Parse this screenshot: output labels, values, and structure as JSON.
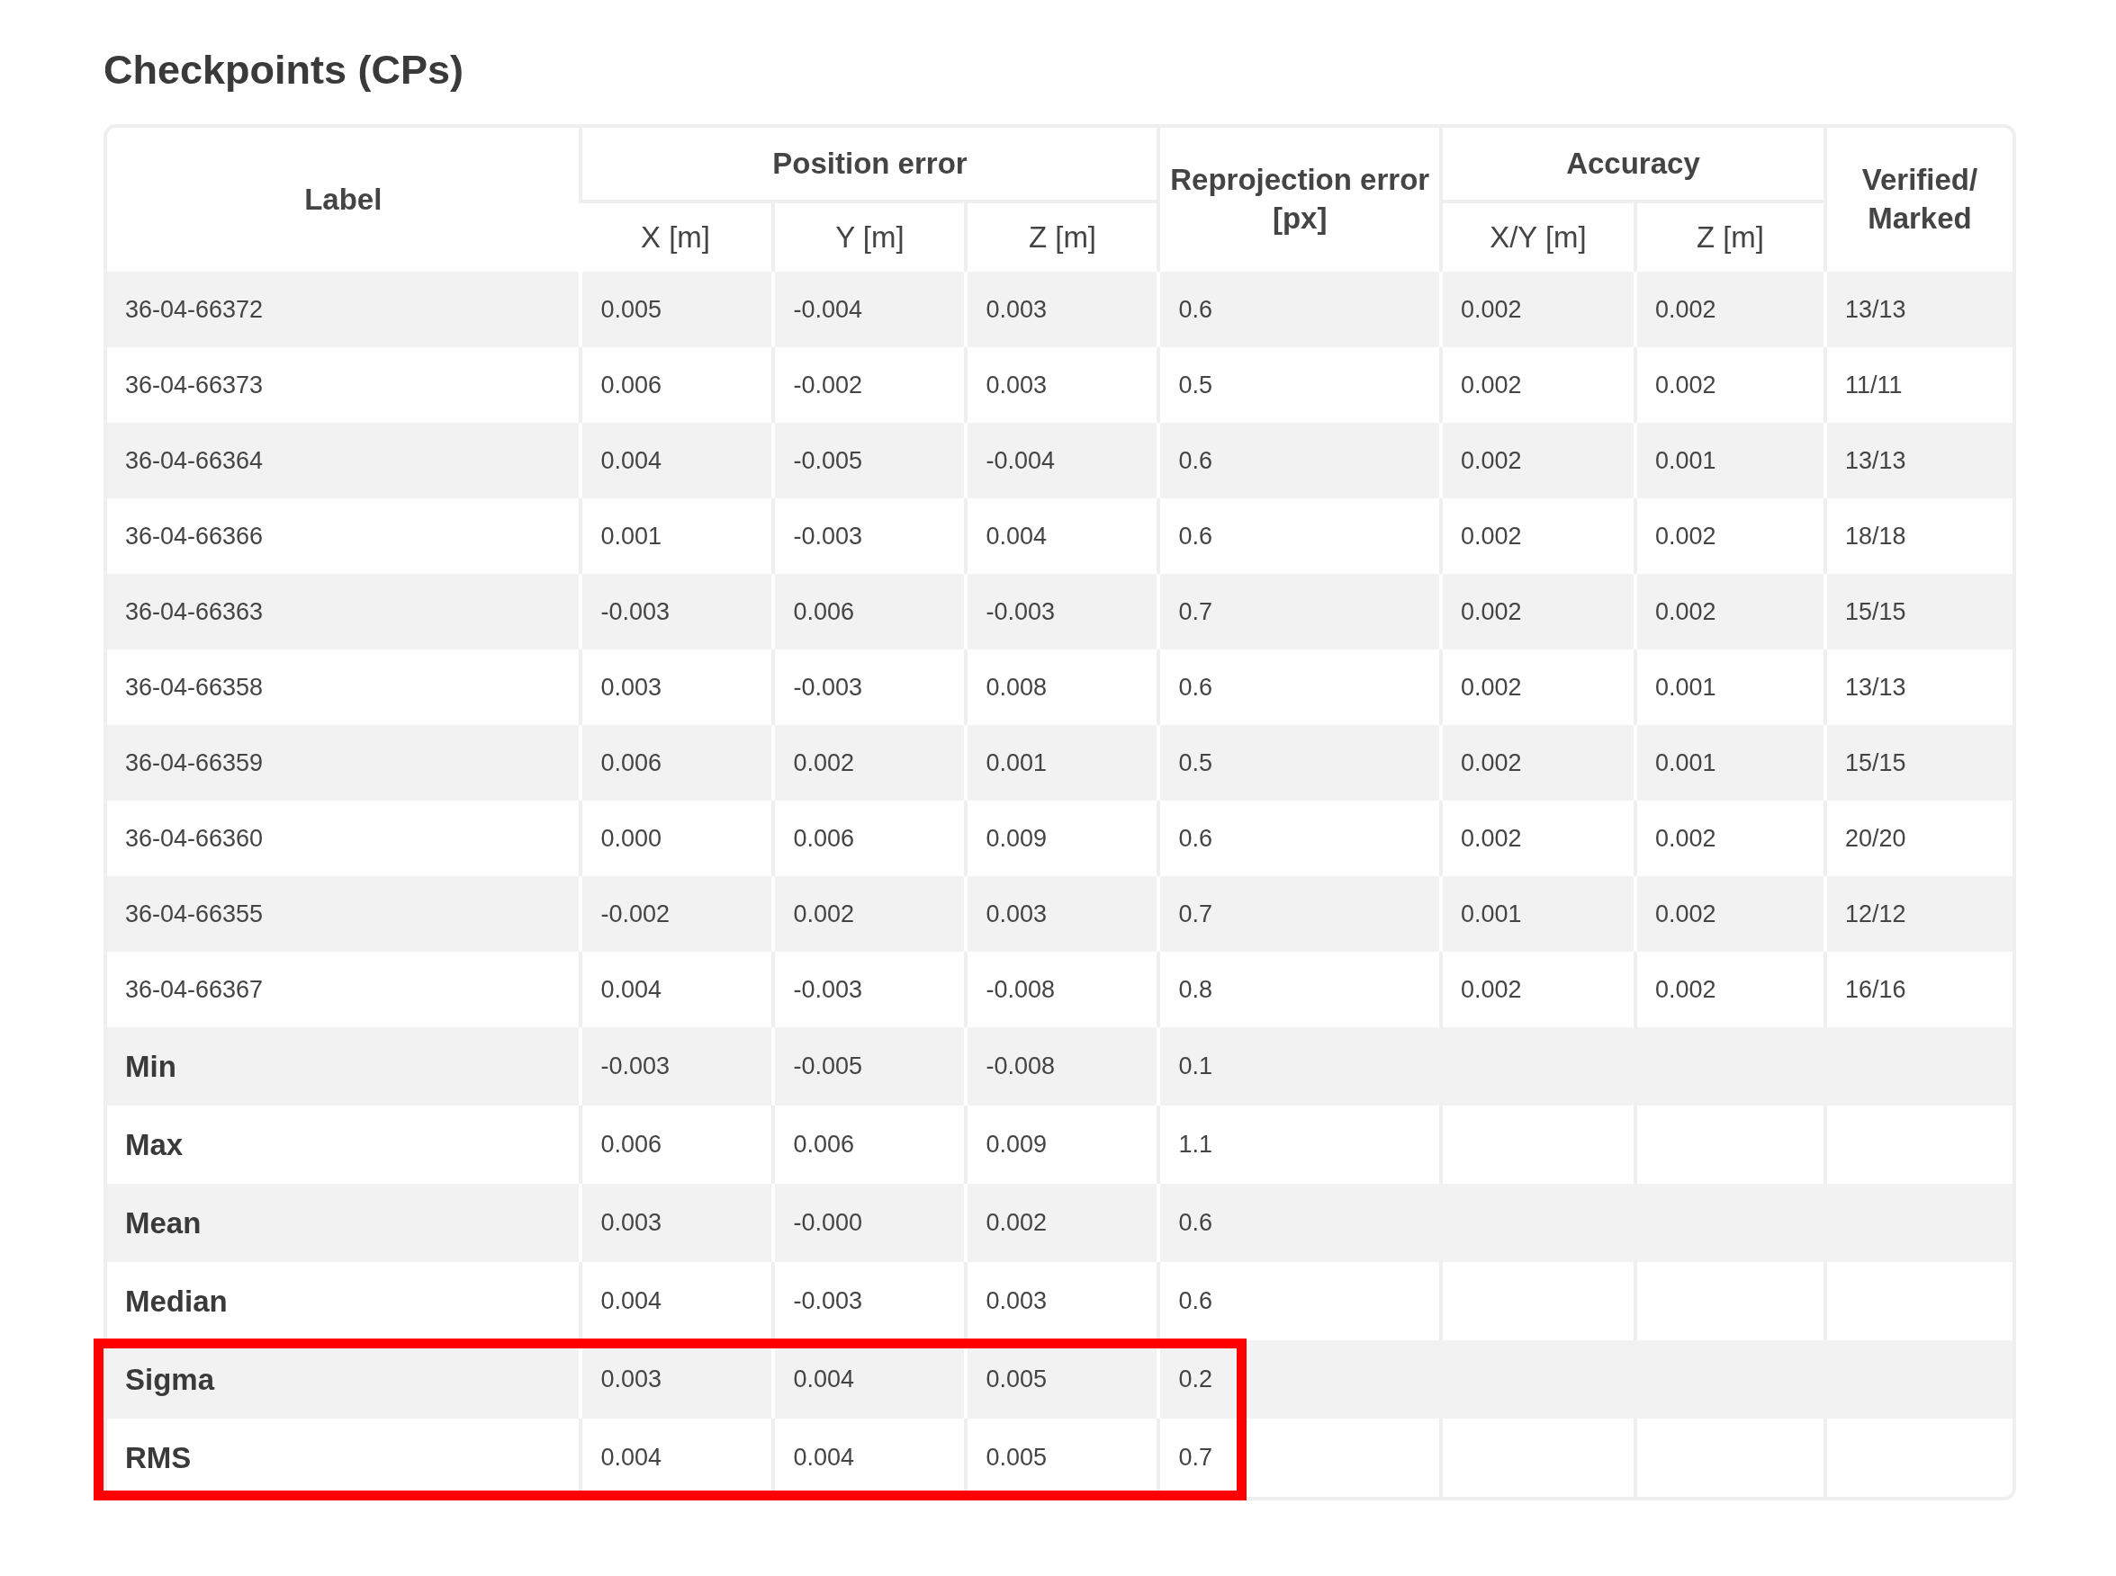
{
  "title": "Checkpoints (CPs)",
  "table": {
    "header_rows": [
      {
        "cells": [
          {
            "label": "Label",
            "rowspan": 2
          },
          {
            "label": "Position error",
            "colspan": 3
          },
          {
            "label": "Reprojection error [px]",
            "rowspan": 2
          },
          {
            "label": "Accuracy",
            "colspan": 2
          },
          {
            "label": "Verified/ Marked",
            "rowspan": 2
          }
        ]
      },
      {
        "cells": [
          {
            "label": "X [m]"
          },
          {
            "label": "Y [m]"
          },
          {
            "label": "Z [m]"
          },
          {
            "label": "X/Y [m]"
          },
          {
            "label": "Z [m]"
          }
        ]
      }
    ],
    "rows": [
      {
        "kind": "point",
        "cells": [
          "36-04-66372",
          "0.005",
          "-0.004",
          "0.003",
          "0.6",
          "0.002",
          "0.002",
          "13/13"
        ],
        "highlighted": false
      },
      {
        "kind": "point",
        "cells": [
          "36-04-66373",
          "0.006",
          "-0.002",
          "0.003",
          "0.5",
          "0.002",
          "0.002",
          "11/11"
        ],
        "highlighted": false
      },
      {
        "kind": "point",
        "cells": [
          "36-04-66364",
          "0.004",
          "-0.005",
          "-0.004",
          "0.6",
          "0.002",
          "0.001",
          "13/13"
        ],
        "highlighted": false
      },
      {
        "kind": "point",
        "cells": [
          "36-04-66366",
          "0.001",
          "-0.003",
          "0.004",
          "0.6",
          "0.002",
          "0.002",
          "18/18"
        ],
        "highlighted": false
      },
      {
        "kind": "point",
        "cells": [
          "36-04-66363",
          "-0.003",
          "0.006",
          "-0.003",
          "0.7",
          "0.002",
          "0.002",
          "15/15"
        ],
        "highlighted": false
      },
      {
        "kind": "point",
        "cells": [
          "36-04-66358",
          "0.003",
          "-0.003",
          "0.008",
          "0.6",
          "0.002",
          "0.001",
          "13/13"
        ],
        "highlighted": false
      },
      {
        "kind": "point",
        "cells": [
          "36-04-66359",
          "0.006",
          "0.002",
          "0.001",
          "0.5",
          "0.002",
          "0.001",
          "15/15"
        ],
        "highlighted": false
      },
      {
        "kind": "point",
        "cells": [
          "36-04-66360",
          "0.000",
          "0.006",
          "0.009",
          "0.6",
          "0.002",
          "0.002",
          "20/20"
        ],
        "highlighted": false
      },
      {
        "kind": "point",
        "cells": [
          "36-04-66355",
          "-0.002",
          "0.002",
          "0.003",
          "0.7",
          "0.001",
          "0.002",
          "12/12"
        ],
        "highlighted": false
      },
      {
        "kind": "point",
        "cells": [
          "36-04-66367",
          "0.004",
          "-0.003",
          "-0.008",
          "0.8",
          "0.002",
          "0.002",
          "16/16"
        ],
        "highlighted": false
      },
      {
        "kind": "summary",
        "cells": [
          "Min",
          "-0.003",
          "-0.005",
          "-0.008",
          "0.1"
        ],
        "highlighted": false
      },
      {
        "kind": "summary",
        "cells": [
          "Max",
          "0.006",
          "0.006",
          "0.009",
          "1.1"
        ],
        "highlighted": false
      },
      {
        "kind": "summary",
        "cells": [
          "Mean",
          "0.003",
          "-0.000",
          "0.002",
          "0.6"
        ],
        "highlighted": false
      },
      {
        "kind": "summary",
        "cells": [
          "Median",
          "0.004",
          "-0.003",
          "0.003",
          "0.6"
        ],
        "highlighted": false
      },
      {
        "kind": "summary",
        "cells": [
          "Sigma",
          "0.003",
          "0.004",
          "0.005",
          "0.2"
        ],
        "highlighted": true
      },
      {
        "kind": "summary",
        "cells": [
          "RMS",
          "0.004",
          "0.004",
          "0.005",
          "0.7"
        ],
        "highlighted": true
      }
    ]
  }
}
